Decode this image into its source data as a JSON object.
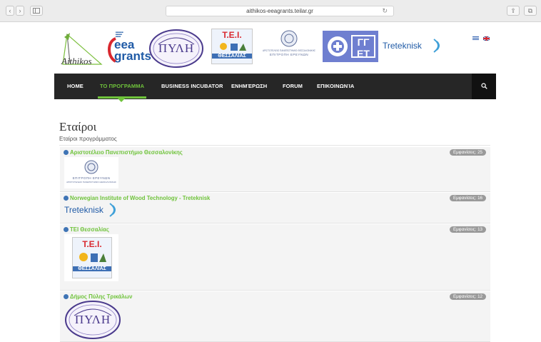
{
  "browser": {
    "url": "aithikos-eeagrants.teilar.gr",
    "reload_glyph": "↻",
    "back_glyph": "‹",
    "forward_glyph": "›",
    "share_glyph": "⇪",
    "tabs_glyph": "⧉"
  },
  "header": {
    "logo_aithikos": "Aithikos",
    "logo_eea_line1": "eea",
    "logo_eea_line2": "grants",
    "logo_pyli": "ΠΥΛΗ",
    "logo_tei_top": "Τ.Ε.Ι.",
    "logo_tei_bottom": "ΘΕΣΣΑΛΙΑΣ",
    "logo_research_line1": "ΑΡΙΣΤΟΤΕΛΕΙΟ ΠΑΝΕΠΙΣΤΗΜΙΟ ΘΕΣΣΑΛΟΝΙΚΗΣ",
    "logo_research_line2": "ΕΠΙΤΡΟΠΗ ΕΡΕΥΝΩΝ",
    "logo_gsrt": "ΓΓ ΕΤ",
    "logo_treteknisk": "Treteknisk",
    "flags": [
      "greek-flag",
      "uk-flag"
    ]
  },
  "nav": {
    "items": [
      {
        "label": "HOME"
      },
      {
        "label": "ΤΟ ΠΡΟΓΡΑΜΜΑ"
      },
      {
        "label": "BUSINESS INCUBATOR"
      },
      {
        "label": "ΕΝΗΜΈΡΩΣΗ"
      },
      {
        "label": "FORUM"
      },
      {
        "label": "ΕΠΙΚΟΙΝΩΝΊΑ"
      }
    ],
    "active_index": 1,
    "search_icon": "search-icon"
  },
  "page": {
    "title": "Εταίροι",
    "subtitle": "Εταίροι προγράμματος"
  },
  "partners": [
    {
      "name": "Αριστοτέλειο Πανεπιστήμιο Θεσσαλονίκης",
      "badge": "Εμφανίσεις: 25",
      "logo_text": "ΕΠΙΤΡΟΠΗ ΕΡΕΥΝΩΝ",
      "logo_text2": "ΑΡΙΣΤΟΤΕΛΕΙΟ ΠΑΝΕΠΙΣΤΗΜΙΟ ΘΕΣΣΑΛΟΝΙΚΗΣ"
    },
    {
      "name": "Norwegian Institute of Wood Technology - Treteknisk",
      "badge": "Εμφανίσεις: 16",
      "logo_text": "Treteknisk"
    },
    {
      "name": "ΤΕΙ Θεσσαλίας",
      "badge": "Εμφανίσεις: 13",
      "logo_text": "Τ.Ε.Ι.",
      "logo_text2": "ΘΕΣΣΑΛΙΑΣ"
    },
    {
      "name": "Δήμος Πύλης Τρικάλων",
      "badge": "Εμφανίσεις: 12",
      "logo_text": "ΠΥΛΗ"
    }
  ],
  "colors": {
    "accent_green": "#6fc33b",
    "nav_bg": "#262626",
    "badge_bg": "#9a9a9a",
    "eea_blue": "#1f5aa6",
    "eea_red": "#d9282f",
    "pyli_purple": "#4a3a8c",
    "treteknisk_blue": "#3fa0d8"
  }
}
